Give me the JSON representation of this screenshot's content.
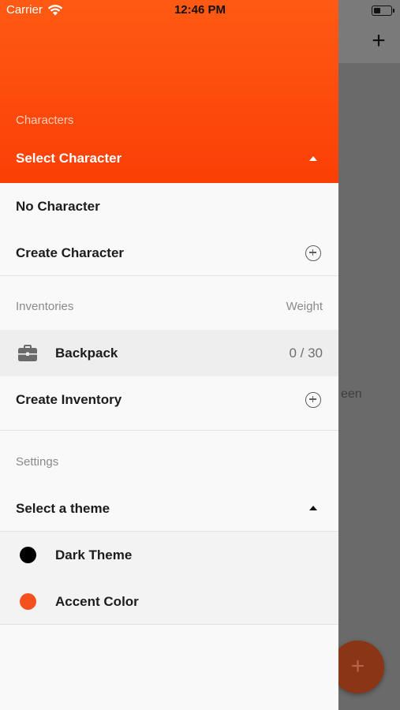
{
  "status_bar": {
    "carrier": "Carrier",
    "time": "12:46 PM"
  },
  "background": {
    "add_symbol": "+",
    "partial_text": "een",
    "fab_symbol": "+"
  },
  "drawer": {
    "header": {
      "section_label": "Characters",
      "select_label": "Select Character",
      "accent_color": "#fb4a0a"
    },
    "characters": {
      "no_character": "No Character",
      "create_character": "Create Character"
    },
    "inventories": {
      "section_label": "Inventories",
      "weight_label": "Weight",
      "items": [
        {
          "name": "Backpack",
          "weight": "0 / 30",
          "icon": "briefcase-icon"
        }
      ],
      "create_inventory": "Create Inventory"
    },
    "settings": {
      "section_label": "Settings",
      "select_theme": "Select a theme",
      "themes": [
        {
          "label": "Dark Theme",
          "color": "#000000"
        },
        {
          "label": "Accent Color",
          "color": "#f4511e"
        }
      ]
    }
  }
}
